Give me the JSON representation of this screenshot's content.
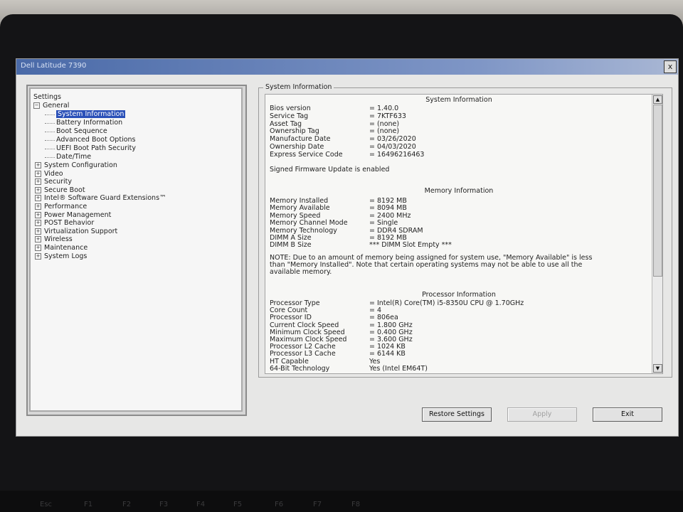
{
  "window": {
    "title": "Dell Latitude 7390",
    "close_label": "x"
  },
  "tree": {
    "root": "Settings",
    "general": {
      "label": "General",
      "items": [
        "System Information",
        "Battery Information",
        "Boot Sequence",
        "Advanced Boot Options",
        "UEFI Boot Path Security",
        "Date/Time"
      ],
      "selected": "System Information"
    },
    "categories": [
      "System Configuration",
      "Video",
      "Security",
      "Secure Boot",
      "Intel® Software Guard Extensions™",
      "Performance",
      "Power Management",
      "POST Behavior",
      "Virtualization Support",
      "Wireless",
      "Maintenance",
      "System Logs"
    ]
  },
  "panel": {
    "legend": "System Information",
    "system_heading": "System Information",
    "system_rows": [
      {
        "label": "Bios version",
        "value": "= 1.40.0"
      },
      {
        "label": "Service Tag",
        "value": "= 7KTF633"
      },
      {
        "label": "Asset Tag",
        "value": "= (none)"
      },
      {
        "label": "Ownership Tag",
        "value": "= (none)"
      },
      {
        "label": "Manufacture Date",
        "value": "= 03/26/2020"
      },
      {
        "label": "Ownership Date",
        "value": "= 04/03/2020"
      },
      {
        "label": "Express Service Code",
        "value": "= 16496216463"
      }
    ],
    "firmware_note": "Signed Firmware Update is enabled",
    "memory_heading": "Memory Information",
    "memory_rows": [
      {
        "label": "Memory Installed",
        "value": "= 8192 MB"
      },
      {
        "label": "Memory Available",
        "value": "= 8094 MB"
      },
      {
        "label": "Memory Speed",
        "value": "= 2400 MHz"
      },
      {
        "label": "Memory Channel Mode",
        "value": "= Single"
      },
      {
        "label": "Memory Technology",
        "value": "= DDR4 SDRAM"
      },
      {
        "label": "DIMM A Size",
        "value": "= 8192 MB"
      },
      {
        "label": "DIMM B Size",
        "value": "*** DIMM Slot Empty ***"
      }
    ],
    "memory_note_1": "NOTE: Due to an amount of memory being assigned for system use, \"Memory Available\" is less",
    "memory_note_2": "than \"Memory Installed\". Note that certain operating systems may not be able to use all the",
    "memory_note_3": "available memory.",
    "processor_heading": "Processor Information",
    "processor_rows": [
      {
        "label": "Processor Type",
        "value": "= Intel(R) Core(TM) i5-8350U CPU @ 1.70GHz"
      },
      {
        "label": "Core Count",
        "value": "= 4"
      },
      {
        "label": "Processor ID",
        "value": "= 806ea"
      },
      {
        "label": "Current Clock Speed",
        "value": "= 1.800 GHz"
      },
      {
        "label": "Minimum Clock Speed",
        "value": "= 0.400 GHz"
      },
      {
        "label": "Maximum Clock Speed",
        "value": "= 3.600 GHz"
      },
      {
        "label": "Processor L2 Cache",
        "value": "= 1024 KB"
      },
      {
        "label": "Processor L3 Cache",
        "value": "= 6144 KB"
      },
      {
        "label": "HT Capable",
        "value": "Yes"
      },
      {
        "label": "64-Bit Technology",
        "value": "Yes (Intel EM64T)"
      }
    ]
  },
  "buttons": {
    "restore": "Restore Settings",
    "apply": "Apply",
    "exit": "Exit"
  },
  "keyboard": [
    "Esc",
    "F1",
    "F2",
    "F3",
    "F4",
    "F5",
    "F6",
    "F7",
    "F8"
  ]
}
